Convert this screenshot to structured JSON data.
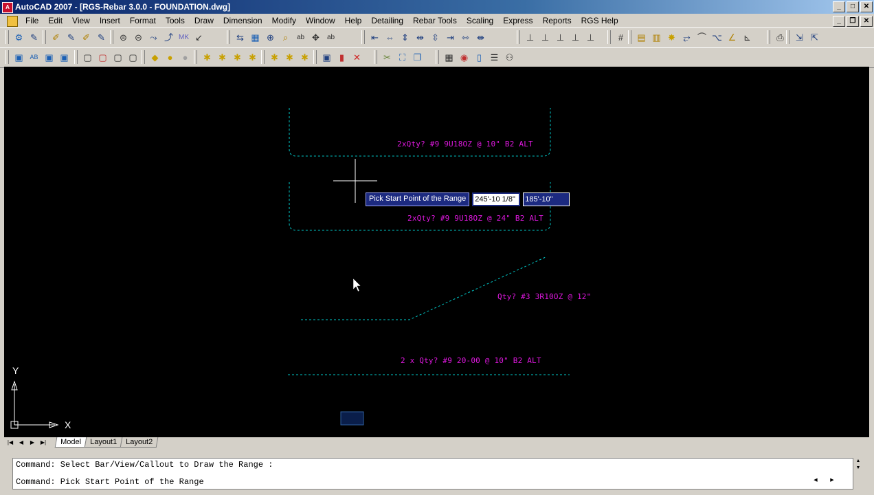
{
  "window": {
    "title": "AutoCAD 2007 - [RGS-Rebar 3.0.0 - FOUNDATION.dwg]",
    "app_icon": "autocad-icon",
    "controls": [
      "minimize",
      "maximize",
      "close"
    ]
  },
  "menubar": {
    "items": [
      "File",
      "Edit",
      "View",
      "Insert",
      "Format",
      "Tools",
      "Draw",
      "Dimension",
      "Modify",
      "Window",
      "Help",
      "Detailing",
      "Rebar Tools",
      "Scaling",
      "Express",
      "Reports",
      "RGS Help"
    ]
  },
  "drawing": {
    "callouts": [
      "2xQty? #9 9U18OZ @ 10\" B2 ALT",
      "2xQty? #9 9U18OZ @ 24\" B2 ALT",
      "Qty? #3 3R10OZ @ 12\"",
      "2 x Qty? #9 20-00 @ 10\" B2 ALT"
    ],
    "dynamic_input": {
      "prompt": "Pick Start Point of the Range",
      "x_value": "245'-10 1/8\"",
      "y_value": "185'-10\""
    },
    "ucs": {
      "x_label": "X",
      "y_label": "Y"
    },
    "colors": {
      "background": "#000000",
      "text": "#e018e0",
      "linework": "#00c8c8"
    }
  },
  "tabs": {
    "items": [
      "Model",
      "Layout1",
      "Layout2"
    ],
    "active": "Model"
  },
  "command": {
    "lines": [
      "Command: Select Bar/View/Callout to Draw the Range :",
      "Command: Pick Start Point of the Range"
    ]
  }
}
